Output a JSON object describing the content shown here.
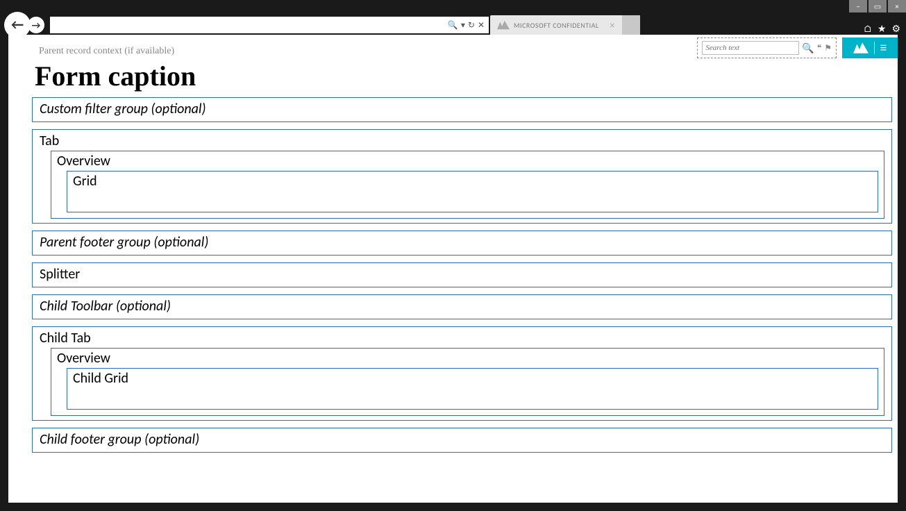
{
  "window": {
    "minimize": "–",
    "maximize": "▭",
    "close": "×"
  },
  "browser": {
    "addr_search_dropdown": "▾",
    "addr_refresh": "↻",
    "addr_stop": "✕",
    "tab_label": "MICROSOFT CONFIDENTIAL",
    "tab_close": "×",
    "home_icon": "⌂",
    "star_icon": "★",
    "gear_icon": "⚙"
  },
  "header": {
    "search_placeholder": "Search text",
    "quote_glyph": "❝",
    "flag_glyph": "⚑",
    "menu_glyph": "≡"
  },
  "page": {
    "breadcrumb": "Parent record context (if available)",
    "caption": "Form caption"
  },
  "regions": {
    "custom_filter": "Custom filter group (optional)",
    "tab": "Tab",
    "overview": "Overview",
    "grid": "Grid",
    "parent_footer": "Parent footer group (optional)",
    "splitter": "Splitter",
    "child_toolbar": "Child Toolbar (optional)",
    "child_tab": "Child Tab",
    "child_overview": "Overview",
    "child_grid": "Child Grid",
    "child_footer": "Child footer group (optional)"
  }
}
